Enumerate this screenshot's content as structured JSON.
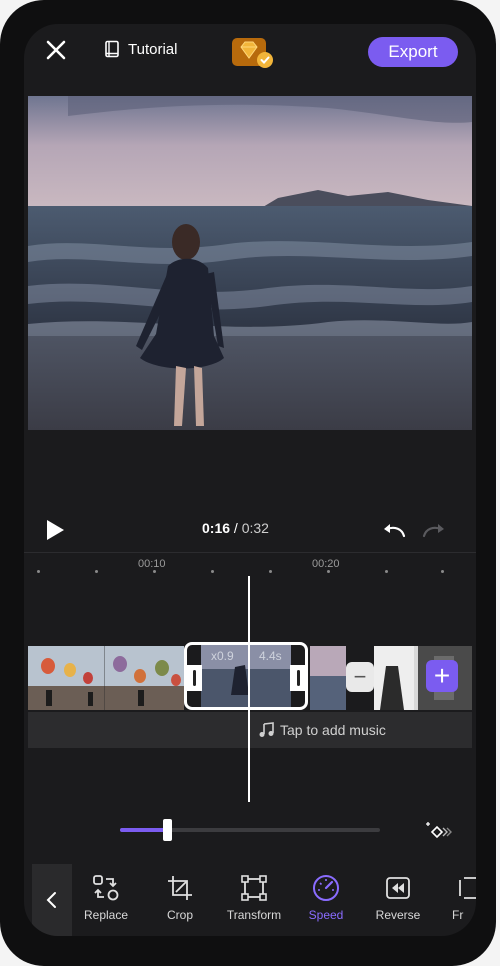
{
  "topbar": {
    "tutorial_label": "Tutorial",
    "export_label": "Export",
    "icons": [
      "close-icon",
      "book-icon",
      "premium-gem-icon"
    ]
  },
  "player": {
    "current_time": "0:16",
    "separator": "/",
    "total_time": "0:32"
  },
  "ruler": {
    "labels": [
      "00:10",
      "00:20"
    ]
  },
  "timeline": {
    "selected_clip": {
      "speed": "x0.9",
      "duration": "4.4s"
    },
    "music_prompt": "Tap to add music"
  },
  "speed_slider": {
    "value": 0.18
  },
  "toolbar": {
    "items": [
      {
        "label": "Replace",
        "icon": "replace-icon"
      },
      {
        "label": "Crop",
        "icon": "crop-icon"
      },
      {
        "label": "Transform",
        "icon": "transform-icon"
      },
      {
        "label": "Speed",
        "icon": "speed-icon",
        "active": true
      },
      {
        "label": "Reverse",
        "icon": "reverse-icon"
      },
      {
        "label": "Fr",
        "icon": "freeze-icon"
      }
    ]
  },
  "colors": {
    "accent": "#7b5cf0",
    "background": "#1b1b1d",
    "music_bar": "#2c2c2e"
  }
}
